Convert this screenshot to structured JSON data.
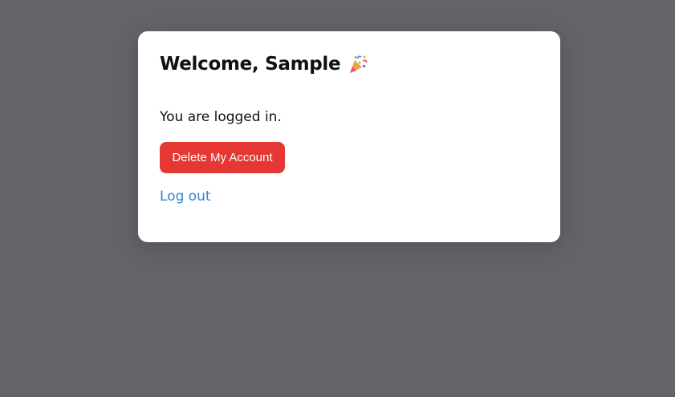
{
  "card": {
    "title": "Welcome, Sample",
    "title_icon": "party-popper-icon",
    "status_text": "You are logged in.",
    "delete_button_label": "Delete My Account",
    "logout_link_label": "Log out"
  },
  "colors": {
    "backdrop": "#636468",
    "card_background": "#ffffff",
    "danger": "#e53835",
    "link": "#2b84d6",
    "text": "#111111"
  }
}
